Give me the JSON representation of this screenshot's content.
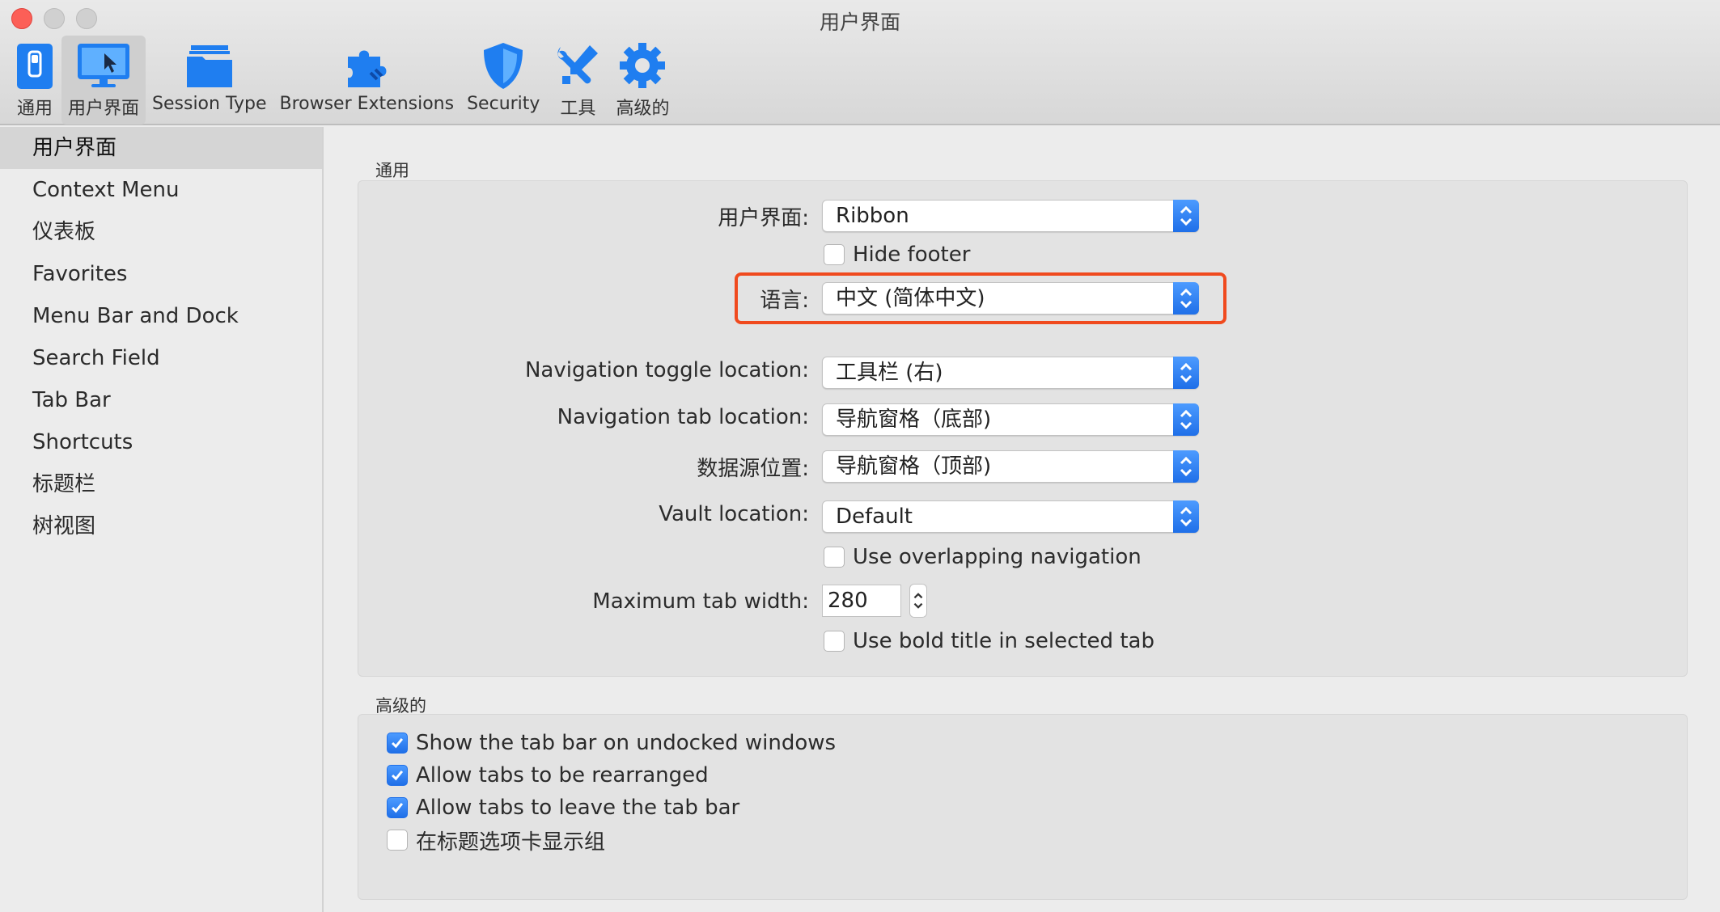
{
  "window": {
    "title": "用户界面"
  },
  "toolbar": {
    "items": [
      {
        "label": "通用",
        "icon": "switch-icon"
      },
      {
        "label": "用户界面",
        "icon": "monitor-icon",
        "selected": true
      },
      {
        "label": "Session Type",
        "icon": "folder-icon"
      },
      {
        "label": "Browser Extensions",
        "icon": "puzzle-icon"
      },
      {
        "label": "Security",
        "icon": "shield-icon"
      },
      {
        "label": "工具",
        "icon": "tools-icon"
      },
      {
        "label": "高级的",
        "icon": "gear-icon"
      }
    ]
  },
  "sidebar": {
    "items": [
      {
        "label": "用户界面",
        "selected": true
      },
      {
        "label": "Context Menu"
      },
      {
        "label": "仪表板"
      },
      {
        "label": "Favorites"
      },
      {
        "label": "Menu Bar and Dock"
      },
      {
        "label": "Search Field"
      },
      {
        "label": "Tab Bar"
      },
      {
        "label": "Shortcuts"
      },
      {
        "label": "标题栏"
      },
      {
        "label": "树视图"
      }
    ]
  },
  "general": {
    "title": "通用",
    "ui_label": "用户界面:",
    "ui_value": "Ribbon",
    "hide_footer": {
      "label": "Hide footer",
      "checked": false
    },
    "language_label": "语言:",
    "language_value": "中文 (简体中文)",
    "nav_toggle_label": "Navigation toggle location:",
    "nav_toggle_value": "工具栏 (右)",
    "nav_tab_label": "Navigation tab location:",
    "nav_tab_value": "导航窗格（底部)",
    "datasource_label": "数据源位置:",
    "datasource_value": "导航窗格（顶部)",
    "vault_label": "Vault location:",
    "vault_value": "Default",
    "overlapping": {
      "label": "Use overlapping navigation",
      "checked": false
    },
    "max_tab_label": "Maximum tab width:",
    "max_tab_value": "280",
    "bold_title": {
      "label": "Use bold title in selected tab",
      "checked": false
    }
  },
  "advanced": {
    "title": "高级的",
    "options": [
      {
        "label": "Show the tab bar on undocked windows",
        "checked": true
      },
      {
        "label": "Allow tabs to be rearranged",
        "checked": true
      },
      {
        "label": "Allow tabs to leave the tab bar",
        "checked": true
      },
      {
        "label": "在标题选项卡显示组",
        "checked": false
      }
    ]
  },
  "colors": {
    "accent": "#1f6fe8",
    "highlight": "#f04a1e",
    "close": "#fc5f57"
  }
}
